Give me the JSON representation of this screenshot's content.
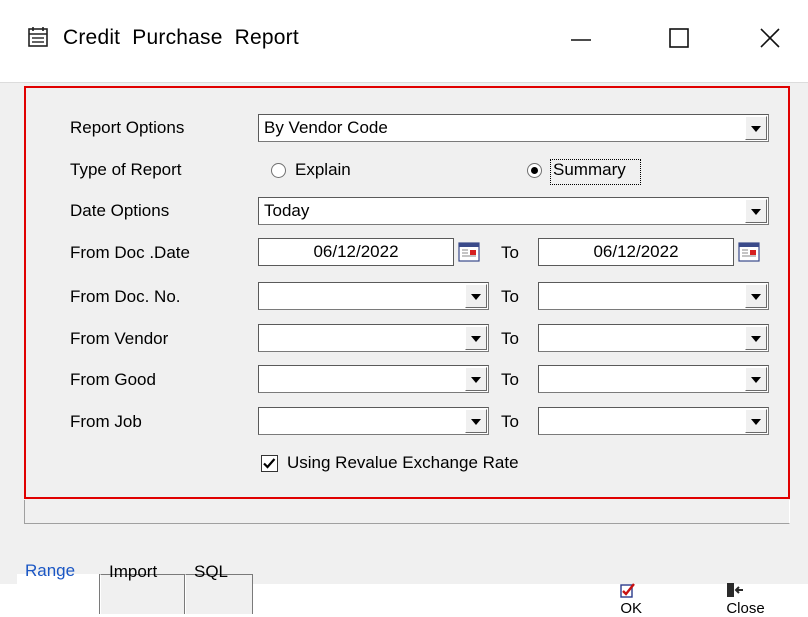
{
  "window": {
    "title": "Credit  Purchase  Report"
  },
  "form": {
    "report_options": {
      "label": "Report Options",
      "value": "By Vendor Code"
    },
    "type_of_report": {
      "label": "Type of Report",
      "options": [
        "Explain",
        "Summary"
      ],
      "selected": "Summary"
    },
    "date_options": {
      "label": "Date Options",
      "value": "Today"
    },
    "from_doc_date": {
      "label": "From Doc .Date",
      "from": "06/12/2022",
      "to_label": "To",
      "to": "06/12/2022"
    },
    "from_doc_no": {
      "label": "From Doc. No.",
      "to_label": "To",
      "from": "",
      "to": ""
    },
    "from_vendor": {
      "label": "From Vendor",
      "to_label": "To",
      "from": "",
      "to": ""
    },
    "from_good": {
      "label": "From Good",
      "to_label": "To",
      "from": "",
      "to": ""
    },
    "from_job": {
      "label": "From Job",
      "to_label": "To",
      "from": "",
      "to": ""
    },
    "revalue": {
      "label": "Using Revalue Exchange Rate",
      "checked": true
    }
  },
  "tabs": [
    {
      "label": "Range",
      "active": true
    },
    {
      "label": "Import",
      "active": false
    },
    {
      "label": "SQL",
      "active": false
    }
  ],
  "buttons": {
    "ok": "OK",
    "close": "Close"
  },
  "colors": {
    "highlight_border": "#e00000",
    "active_tab_text": "#1a56c4",
    "client_bg": "#f0f0f0"
  },
  "icons": {
    "window": "report-window-icon",
    "calendar": "calendar-icon",
    "ok": "ok-check-icon",
    "close": "close-door-icon"
  }
}
